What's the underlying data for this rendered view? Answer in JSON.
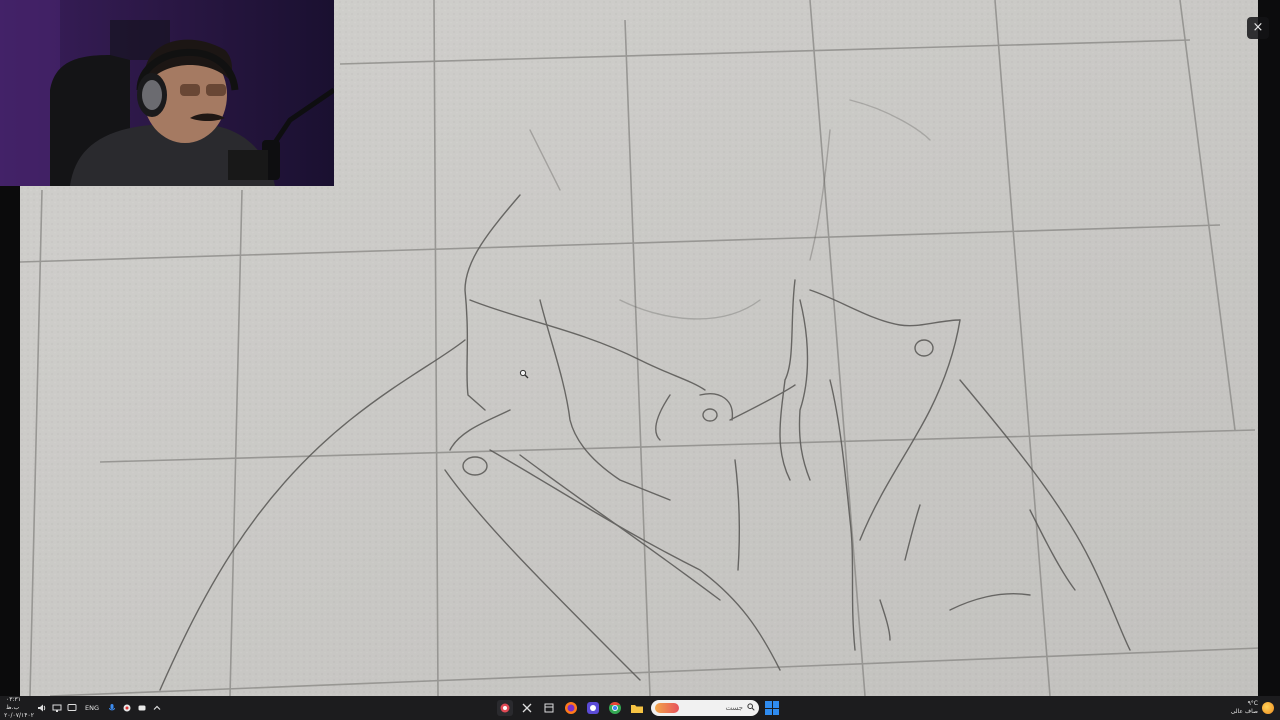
{
  "overlay": {
    "close_label": "×"
  },
  "taskbar": {
    "clock": {
      "time": "۰۳:۳۱ ب.ظ",
      "date": "۲۰/۰۷/۱۴۰۲"
    },
    "language": "ENG",
    "search_placeholder": "جست",
    "weather": {
      "temperature": "۹°C",
      "condition": "صاف عالی"
    },
    "tray_icons": [
      "volume-icon",
      "network-icon",
      "monitor-icon",
      "microphone-icon",
      "app-icon",
      "app-icon",
      "chevron-up-icon"
    ],
    "apps": [
      "app-icon",
      "snipping-tool-icon",
      "task-view-icon",
      "firefox-icon",
      "app-icon",
      "chrome-icon",
      "file-explorer-icon"
    ]
  }
}
